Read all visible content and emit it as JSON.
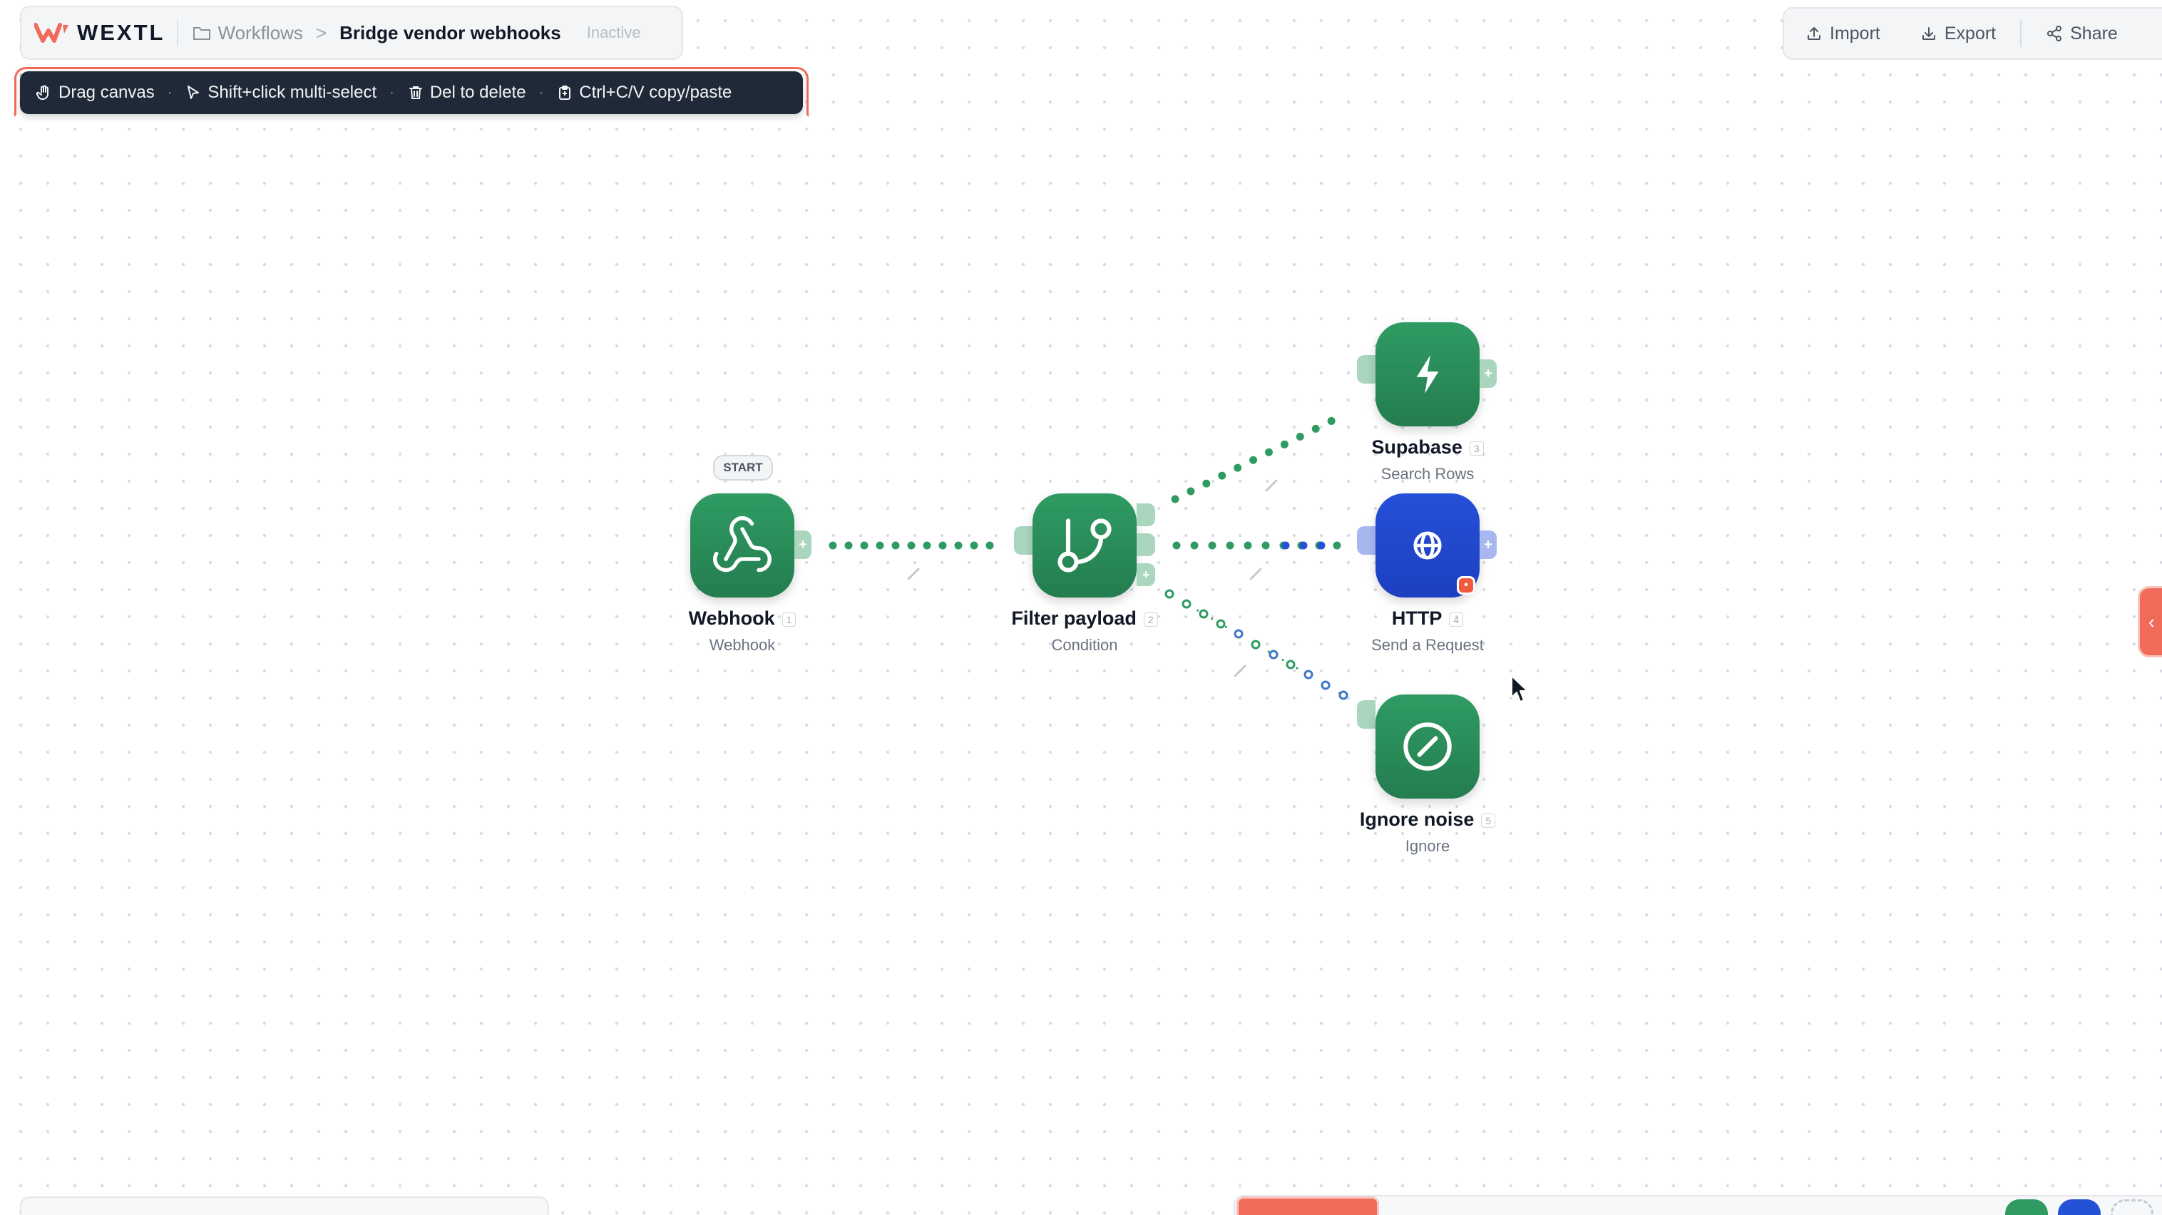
{
  "header": {
    "brand": "WEXTL",
    "breadcrumb_root": "Workflows",
    "breadcrumb_sep": ">",
    "workflow_name": "Bridge vendor webhooks",
    "status": "Inactive"
  },
  "shortcuts": [
    {
      "icon": "hand-icon",
      "label": "Drag canvas"
    },
    {
      "icon": "pointer-icon",
      "label": "Shift+click multi-select"
    },
    {
      "icon": "trash-icon",
      "label": "Del to delete"
    },
    {
      "icon": "clipboard-icon",
      "label": "Ctrl+C/V copy/paste"
    }
  ],
  "actions": {
    "import_label": "Import",
    "export_label": "Export",
    "share_label": "Share"
  },
  "nodes": [
    {
      "title": "Webhook",
      "index": "1",
      "subtitle": "Webhook",
      "icon": "webhook-icon",
      "color": "#2f9b63",
      "start_label": "START"
    },
    {
      "title": "Filter payload",
      "index": "2",
      "subtitle": "Condition",
      "icon": "branch-icon",
      "color": "#2f9b63"
    },
    {
      "title": "Supabase",
      "index": "3",
      "subtitle": "Search Rows",
      "icon": "bolt-icon",
      "color": "#2f9b63"
    },
    {
      "title": "HTTP",
      "index": "4",
      "subtitle": "Send a Request",
      "icon": "globe-icon",
      "color": "#2550d8"
    },
    {
      "title": "Ignore noise",
      "index": "5",
      "subtitle": "Ignore",
      "icon": "slash-circle-icon",
      "color": "#2f9b63"
    }
  ],
  "colors": {
    "accent_red": "#f26b5a",
    "node_green": "#2f9b63",
    "node_blue": "#2550d8",
    "toolbar_dark": "#1f2937"
  }
}
